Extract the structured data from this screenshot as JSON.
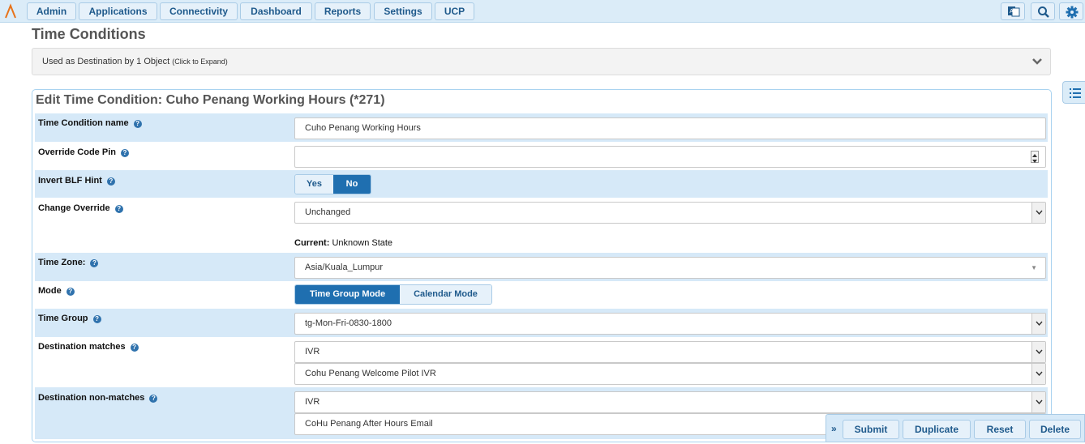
{
  "nav": {
    "items": [
      "Admin",
      "Applications",
      "Connectivity",
      "Dashboard",
      "Reports",
      "Settings",
      "UCP"
    ],
    "tools": [
      "language-icon",
      "search-icon",
      "gear-icon"
    ]
  },
  "page_title": "Time Conditions",
  "destination_bar": {
    "text": "Used as Destination by 1 Object",
    "hint": "(Click to Expand)"
  },
  "form": {
    "title": "Edit Time Condition: Cuho Penang Working Hours (*271)",
    "fields": {
      "name": {
        "label": "Time Condition name",
        "value": "Cuho Penang Working Hours"
      },
      "override_pin": {
        "label": "Override Code Pin",
        "value": ""
      },
      "invert_blf": {
        "label": "Invert BLF Hint",
        "options": [
          "Yes",
          "No"
        ],
        "selected": "No"
      },
      "change_override": {
        "label": "Change Override",
        "value": "Unchanged",
        "current_label": "Current:",
        "current_value": "Unknown State"
      },
      "timezone": {
        "label": "Time Zone:",
        "value": "Asia/Kuala_Lumpur"
      },
      "mode": {
        "label": "Mode",
        "options": [
          "Time Group Mode",
          "Calendar Mode"
        ],
        "selected": "Time Group Mode"
      },
      "time_group": {
        "label": "Time Group",
        "value": "tg-Mon-Fri-0830-1800"
      },
      "dest_match": {
        "label": "Destination matches",
        "type": "IVR",
        "target": "Cohu Penang Welcome Pilot IVR"
      },
      "dest_nonmatch": {
        "label": "Destination non-matches",
        "type": "IVR",
        "target": "CoHu Penang After Hours Email"
      }
    }
  },
  "actions": [
    "Submit",
    "Duplicate",
    "Reset",
    "Delete"
  ],
  "colors": {
    "accent": "#1f6fb0",
    "shaded_row": "#d6e9f8",
    "nav_bg": "#dbecf8"
  }
}
